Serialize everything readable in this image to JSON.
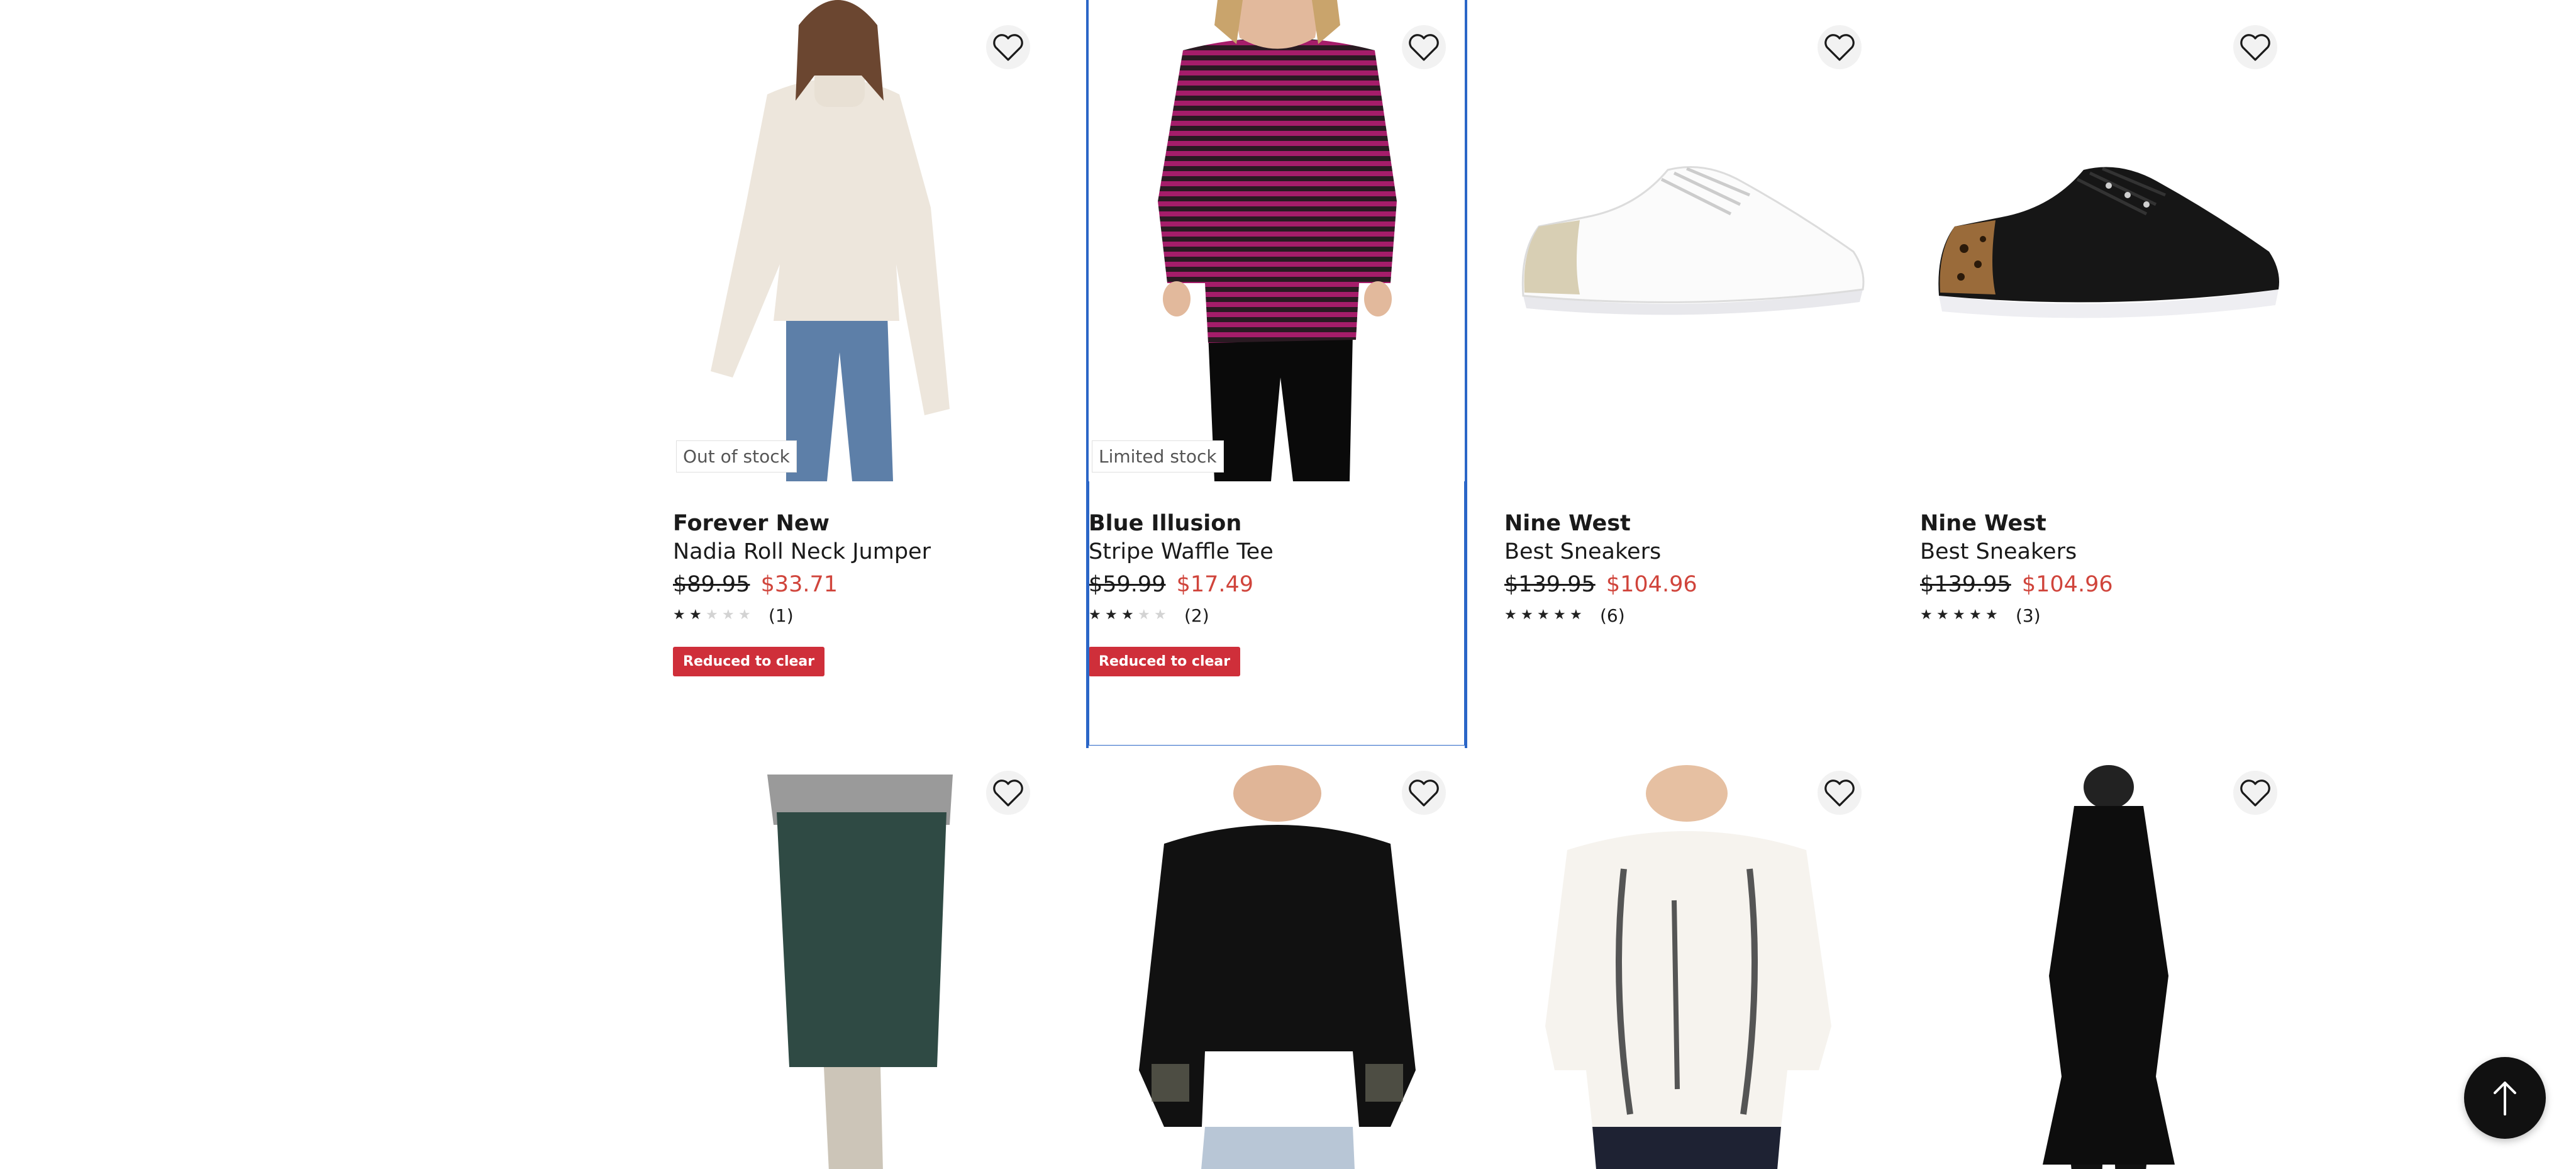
{
  "products_row1": [
    {
      "brand": "Forever New",
      "title": "Nadia Roll Neck Jumper",
      "was_price": "$89.95",
      "now_price": "$33.71",
      "rating": 2,
      "review_count": "(1)",
      "stock_badge": "Out of stock",
      "promo": "Reduced to clear"
    },
    {
      "brand": "Blue Illusion",
      "title": "Stripe Waffle Tee",
      "was_price": "$59.99",
      "now_price": "$17.49",
      "rating": 3,
      "review_count": "(2)",
      "stock_badge": "Limited stock",
      "promo": "Reduced to clear"
    },
    {
      "brand": "Nine West",
      "title": "Best Sneakers",
      "was_price": "$139.95",
      "now_price": "$104.96",
      "rating": 5,
      "review_count": "(6)",
      "stock_badge": "",
      "promo": ""
    },
    {
      "brand": "Nine West",
      "title": "Best Sneakers",
      "was_price": "$139.95",
      "now_price": "$104.96",
      "rating": 4.5,
      "review_count": "(3)",
      "stock_badge": "",
      "promo": ""
    }
  ],
  "colors": {
    "sale_price": "#d0443b",
    "promo_badge": "#cf2f3a",
    "focus_outline": "#2b66c7"
  },
  "icons": {
    "wishlist": "heart-outline-icon",
    "back_to_top": "arrow-up-icon"
  }
}
